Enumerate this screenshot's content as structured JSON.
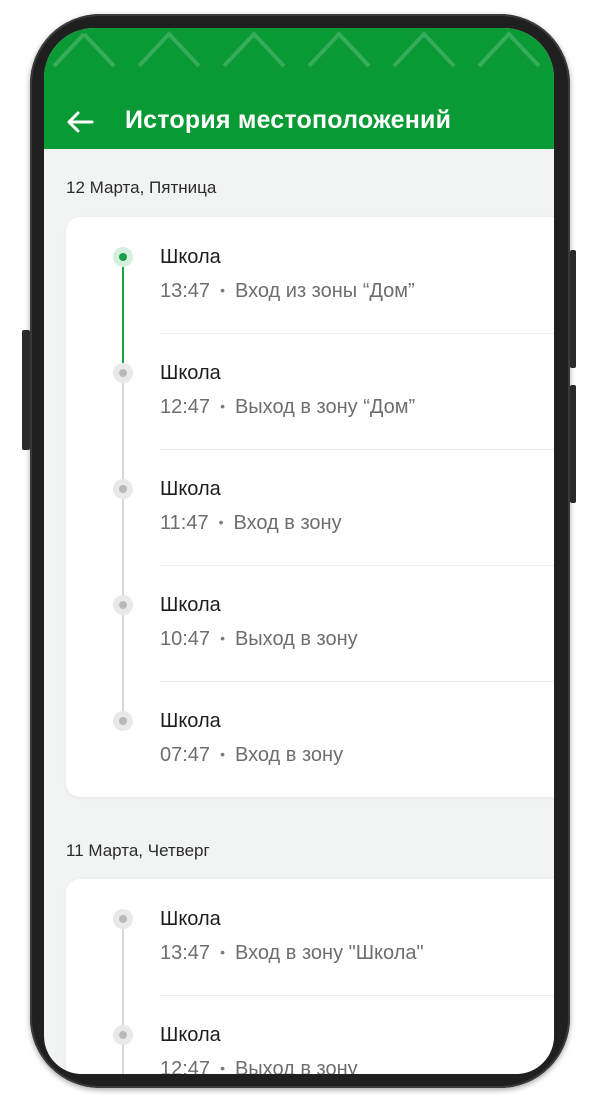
{
  "colors": {
    "header_bg": "#0a9a35",
    "accent": "#18a14a",
    "screen_bg": "#f1f4f2",
    "card_bg": "#ffffff"
  },
  "header": {
    "title": "История местоположений",
    "back_icon": "arrow-left-icon"
  },
  "sections": [
    {
      "date": "12 Марта, Пятница",
      "events": [
        {
          "place": "Школа",
          "time": "13:47",
          "action": "Вход из зоны “Дом”",
          "active": true
        },
        {
          "place": "Школа",
          "time": "12:47",
          "action": "Выход в зону “Дом”",
          "active": false
        },
        {
          "place": "Школа",
          "time": "11:47",
          "action": "Вход в зону",
          "active": false
        },
        {
          "place": "Школа",
          "time": "10:47",
          "action": "Выход в зону",
          "active": false
        },
        {
          "place": "Школа",
          "time": "07:47",
          "action": "Вход в зону",
          "active": false
        }
      ]
    },
    {
      "date": "11 Марта, Четверг",
      "events": [
        {
          "place": "Школа",
          "time": "13:47",
          "action": "Вход в зону \"Школа\"",
          "active": false
        },
        {
          "place": "Школа",
          "time": "12:47",
          "action": "Выход в зону",
          "active": false
        }
      ]
    }
  ],
  "separator": "•"
}
